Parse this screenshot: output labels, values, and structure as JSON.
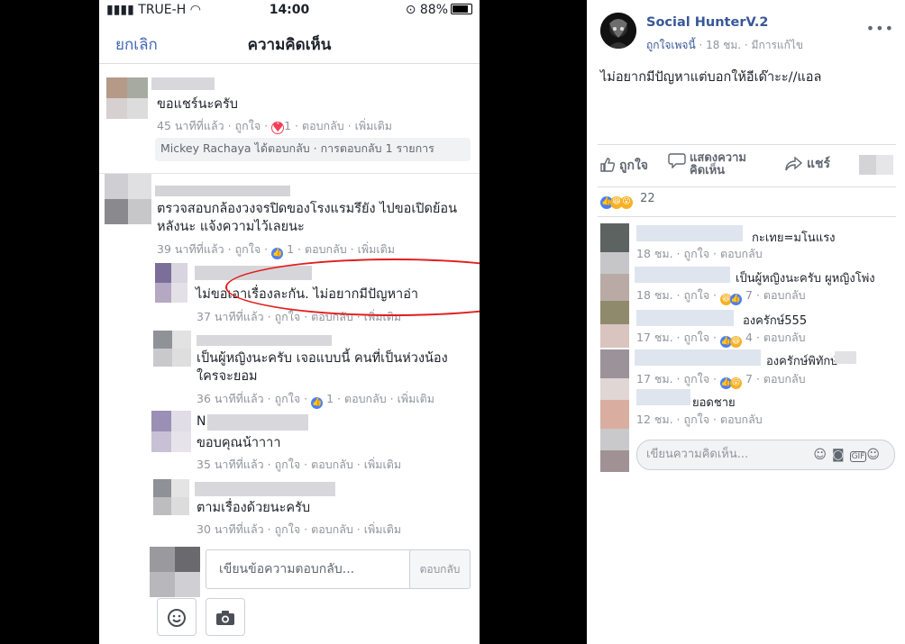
{
  "phone": {
    "status": {
      "carrier": "TRUE-H",
      "time": "14:00",
      "battery": "88%"
    },
    "nav": {
      "cancel": "ยกเลิก",
      "title": "ความคิดเห็น"
    },
    "comments": [
      {
        "text": "ขอแชร์นะครับ",
        "time": "45 นาทีที่แล้ว",
        "like": "ถูกใจ",
        "react_count": "1",
        "reply": "ตอบกลับ",
        "more": "เพิ่มเติม",
        "reply_summary": "Mickey Rachaya ได้ตอบกลับ · การตอบกลับ 1 รายการ"
      },
      {
        "text": "ตรวจสอบกล้องวงจรปิดของโรงแรมรึยัง ไปขอเปิดย้อนหลังนะ แจ้งความไว้เลยนะ",
        "time": "39 นาทีที่แล้ว",
        "like": "ถูกใจ",
        "react_count": "1",
        "reply": "ตอบกลับ",
        "more": "เพิ่มเติม"
      },
      {
        "text": "ไม่ขอเอาเรื่องละกัน. ไม่อยากมีปัญหาอ่า",
        "time": "37 นาทีที่แล้ว",
        "like": "ถูกใจ",
        "reply": "ตอบกลับ",
        "more": "เพิ่มเติม"
      },
      {
        "text": "เป็นผู้หญิงนะครับ เจอแบบนี้ คนที่เป็นห่วงน้องใครจะยอม",
        "time": "36 นาทีที่แล้ว",
        "like": "ถูกใจ",
        "react_count": "1",
        "reply": "ตอบกลับ",
        "more": "เพิ่มเติม"
      },
      {
        "name_initial": "N",
        "text": "ขอบคุณน้าาาา",
        "time": "35 นาทีที่แล้ว",
        "like": "ถูกใจ",
        "reply": "ตอบกลับ",
        "more": "เพิ่มเติม"
      },
      {
        "text": "ตามเรื่องด้วยนะครับ",
        "time": "30 นาทีที่แล้ว",
        "like": "ถูกใจ",
        "reply": "ตอบกลับ",
        "more": "เพิ่มเติม"
      }
    ],
    "reply_input": {
      "placeholder": "เขียนข้อความตอบกลับ...",
      "button": "ตอบกลับ"
    }
  },
  "post": {
    "page_name": "Social HunterV.2",
    "sub_liked": "ถูกใจเพจนี้",
    "sub_time": "18 ชม.",
    "sub_edited": "มีการแก้ไข",
    "text": "ไม่อยากมีปัญหาแต่บอกให้อีเด๊าะะ//แอล",
    "actions": {
      "like": "ถูกใจ",
      "comment": "แสดงความคิดเห็น",
      "share": "แชร์"
    },
    "reaction_count": "22",
    "comments": [
      {
        "text": "กะเทย=มโนแรง",
        "time": "18 ชม.",
        "like": "ถูกใจ",
        "reply": "ตอบกลับ"
      },
      {
        "text": "เป็นผู้หญิงนะครับ ผูหญิงโพ่ง",
        "time": "18 ชม.",
        "like": "ถูกใจ",
        "react_count": "7",
        "reply": "ตอบกลับ"
      },
      {
        "text": "องครักษ์555",
        "time": "17 ชม.",
        "like": "ถูกใจ",
        "react_count": "4",
        "reply": "ตอบกลับ"
      },
      {
        "text": "องครักษ์พิทักษ์",
        "time": "17 ชม.",
        "like": "ถูกใจ",
        "react_count": "7",
        "reply": "ตอบกลับ"
      },
      {
        "text": "ยอดชาย",
        "time": "12 ชม.",
        "like": "ถูกใจ",
        "reply": "ตอบกลับ"
      }
    ],
    "comment_input": {
      "placeholder": "เขียนความคิดเห็น..."
    }
  },
  "colors": {
    "fb_blue": "#4267b2",
    "link_blue": "#385898",
    "circle_red": "#e21e1e",
    "meta_grey": "#90949c"
  }
}
